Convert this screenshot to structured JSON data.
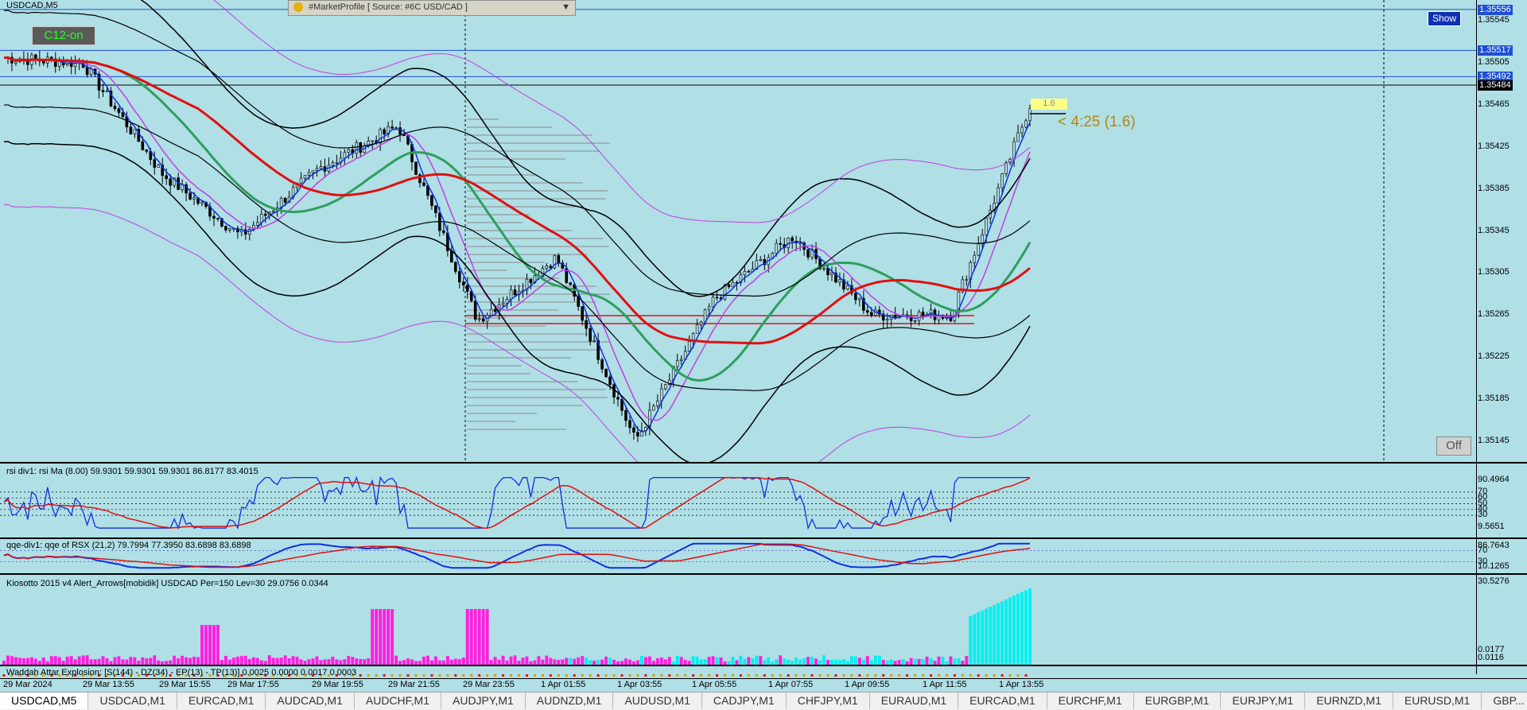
{
  "symbol_title": "USDCAD,M5",
  "market_profile_label": "#MarketProfile [ Source: #6C USD/CAD ]",
  "buttons": {
    "show": "Show",
    "off": "Off",
    "c12": "C12-on"
  },
  "timer_label": "< 4:25 (1.6)",
  "timer_badge": "1.6",
  "price_scale": [
    "1.35545",
    "1.35505",
    "1.35465",
    "1.35425",
    "1.35385",
    "1.35345",
    "1.35305",
    "1.35265",
    "1.35225",
    "1.35185",
    "1.35145"
  ],
  "price_tags": [
    {
      "value": "1.35556",
      "color": "#1e4fd6"
    },
    {
      "value": "1.35517",
      "color": "#1e4fd6"
    },
    {
      "value": "1.35492",
      "color": "#1e4fd6"
    },
    {
      "value": "1.35484",
      "color": "#000000"
    }
  ],
  "rsi_pane": {
    "label": "rsi div1: rsi Ma (8.00) 59.9301 59.9301 59.9301 86.8177 83.4015",
    "scale": [
      "90.4964",
      "70",
      "60",
      "50",
      "40",
      "30",
      "9.5651"
    ]
  },
  "qqe_pane": {
    "label": "qqe-div1: qqe of RSX (21,2) 79.7994 77.3950 83.6898 83.6898",
    "scale": [
      "86.7643",
      "70",
      "30",
      "10.1265"
    ]
  },
  "kiosotto_pane": {
    "label": "Kiosotto 2015 v4 Alert_Arrows[mobidik] USDCAD Per=150 Lev=30 29.0756 0.0344",
    "scale": [
      "30.5276",
      "0.0177",
      "0.0116"
    ]
  },
  "waddah_pane": {
    "label": "Waddah Attar Explosion: [S(144) - DZ(34) - EP(13) - TP(13)] 0.0025 0.0000 0.0017 0.0003"
  },
  "time_axis": [
    "29 Mar 2024",
    "29 Mar 13:55",
    "29 Mar 15:55",
    "29 Mar 17:55",
    "29 Mar 19:55",
    "29 Mar 21:55",
    "29 Mar 23:55",
    "1 Apr 01:55",
    "1 Apr 03:55",
    "1 Apr 05:55",
    "1 Apr 07:55",
    "1 Apr 09:55",
    "1 Apr 11:55",
    "1 Apr 13:55"
  ],
  "tabs": [
    "USDCAD,M5",
    "USDCAD,M1",
    "EURCAD,M1",
    "AUDCAD,M1",
    "AUDCHF,M1",
    "AUDJPY,M1",
    "AUDNZD,M1",
    "AUDUSD,M1",
    "CADJPY,M1",
    "CHFJPY,M1",
    "EURAUD,M1",
    "EURCAD,M1",
    "EURCHF,M1",
    "EURGBP,M1",
    "EURJPY,M1",
    "EURNZD,M1",
    "EURUSD,M1",
    "GBP..."
  ],
  "colors": {
    "background": "#b0dfe6",
    "candle": "#000000",
    "ma_red": "#e01010",
    "ma_green": "#2e9e5e",
    "ma_blue": "#1030e0",
    "band_purple": "#c040e0",
    "hist_magenta": "#ff20e0",
    "hist_cyan": "#00f0f0",
    "rsi_blue": "#1030e0",
    "rsi_red": "#e01010"
  },
  "chart_data": {
    "type": "line",
    "title": "USDCAD,M5",
    "ylim": [
      1.35125,
      1.35565
    ],
    "x": [
      "29 Mar 2024",
      "29 Mar 13:55",
      "29 Mar 15:55",
      "29 Mar 17:55",
      "29 Mar 19:55",
      "29 Mar 21:55",
      "29 Mar 23:55",
      "1 Apr 01:55",
      "1 Apr 03:55",
      "1 Apr 05:55",
      "1 Apr 07:55",
      "1 Apr 09:55",
      "1 Apr 11:55",
      "1 Apr 13:55"
    ],
    "series": [
      {
        "values": [
          1.3551,
          1.35505,
          1.354,
          1.3534,
          1.35405,
          1.35445,
          1.3526,
          1.3532,
          1.35145,
          1.3528,
          1.3534,
          1.35265,
          1.35265,
          1.35465
        ]
      }
    ],
    "levels": [
      1.35556,
      1.35517,
      1.35492,
      1.35484
    ]
  }
}
